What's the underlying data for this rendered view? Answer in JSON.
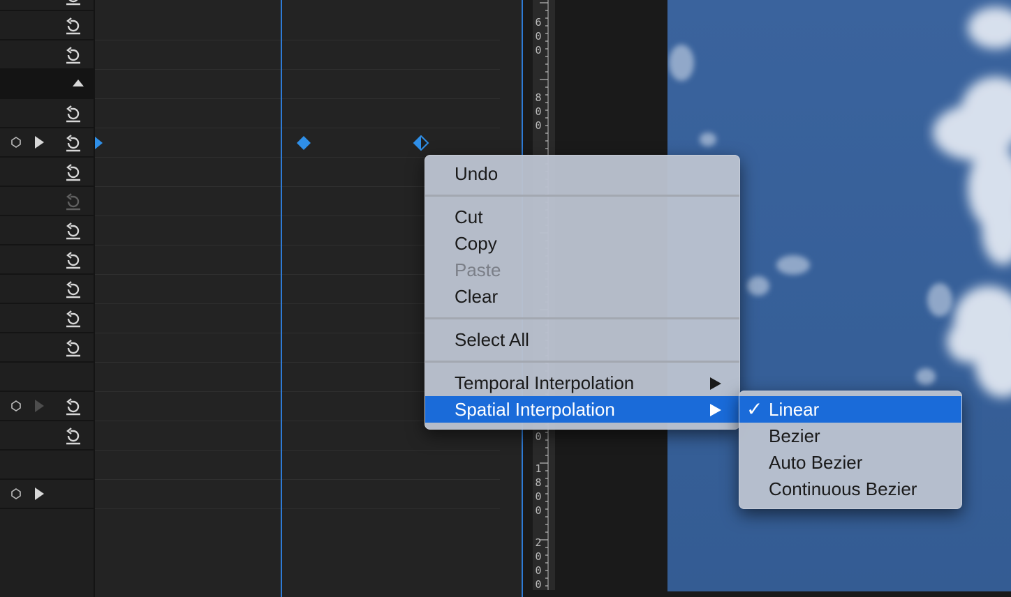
{
  "context_menu": {
    "items": [
      {
        "label": "Undo"
      },
      {
        "label": "Cut"
      },
      {
        "label": "Copy"
      },
      {
        "label": "Paste",
        "disabled": true
      },
      {
        "label": "Clear"
      },
      {
        "label": "Select All"
      },
      {
        "label": "Temporal Interpolation",
        "submenu": true
      },
      {
        "label": "Spatial Interpolation",
        "submenu": true,
        "highlighted": true
      }
    ]
  },
  "submenu": {
    "items": [
      {
        "label": "Linear",
        "checked": true,
        "highlighted": true
      },
      {
        "label": "Bezier"
      },
      {
        "label": "Auto Bezier"
      },
      {
        "label": "Continuous Bezier"
      }
    ]
  },
  "ruler": {
    "labels": [
      "600",
      "800",
      "0",
      "1800",
      "2000"
    ]
  },
  "icons": {
    "reset": "reset-parameter-icon",
    "keyframe": "keyframe-diamond-icon",
    "toggle_animation": "toggle-animation-icon"
  },
  "colors": {
    "accent": "#1a6bd9",
    "playhead": "#2e7bd6",
    "keyframe": "#2f8fe8",
    "panel_bg": "#232323",
    "menu_bg": "#bac1ce"
  }
}
